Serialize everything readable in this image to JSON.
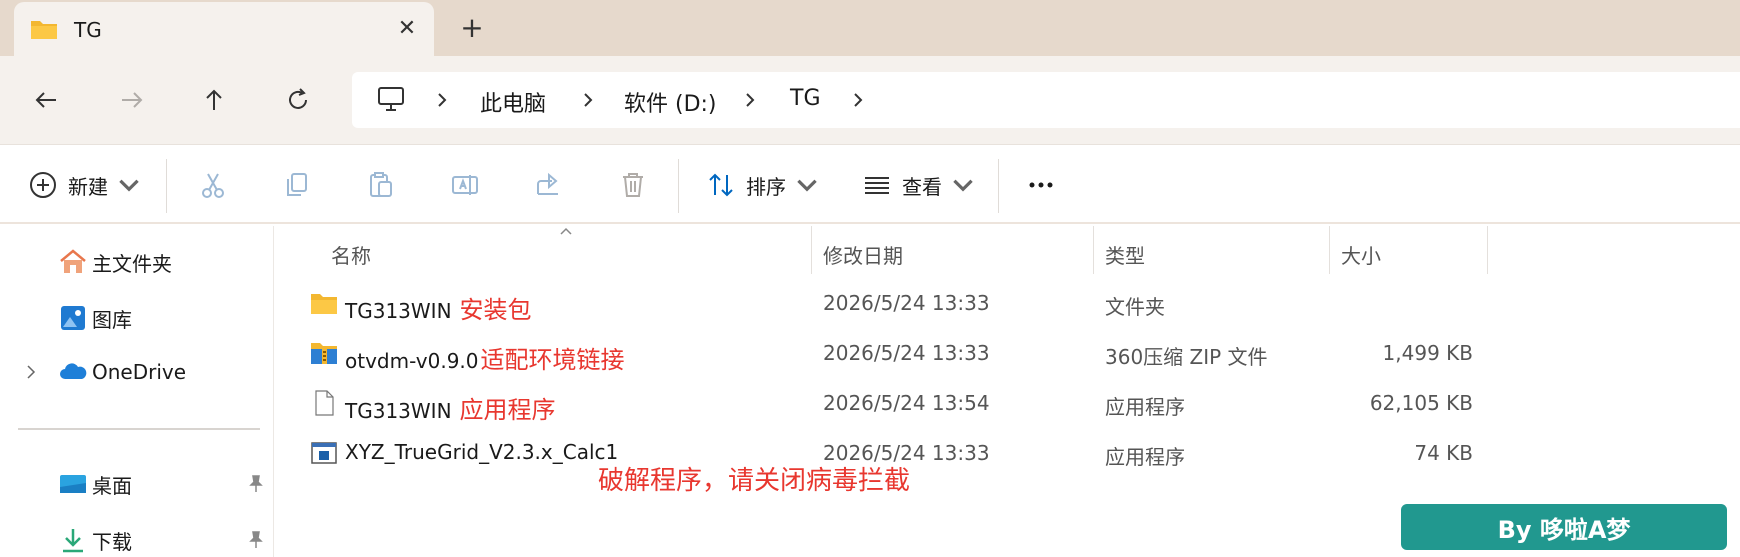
{
  "tab": {
    "title": "TG",
    "close_icon": "close-icon",
    "new_tab_icon": "plus-icon"
  },
  "nav": {
    "back": "back-arrow-icon",
    "forward": "forward-arrow-icon",
    "up": "up-arrow-icon",
    "refresh": "refresh-icon"
  },
  "breadcrumb": {
    "root_icon": "computer-icon",
    "items": [
      "此电脑",
      "软件 (D:)",
      "TG"
    ]
  },
  "toolbar": {
    "new_label": "新建",
    "sort_label": "排序",
    "view_label": "查看",
    "icons": [
      "cut-icon",
      "copy-icon",
      "paste-icon",
      "rename-icon",
      "share-icon",
      "delete-icon",
      "more-icon"
    ]
  },
  "sidebar": {
    "items": [
      {
        "label": "主文件夹",
        "icon": "home-icon"
      },
      {
        "label": "图库",
        "icon": "gallery-icon"
      },
      {
        "label": "OneDrive",
        "icon": "cloud-icon"
      },
      {
        "label": "桌面",
        "icon": "desktop-icon"
      },
      {
        "label": "下载",
        "icon": "download-icon"
      }
    ]
  },
  "columns": {
    "name": "名称",
    "date": "修改日期",
    "type": "类型",
    "size": "大小"
  },
  "files": [
    {
      "name": "TG313WIN",
      "note": "安装包",
      "date": "2026/5/24 13:33",
      "type": "文件夹",
      "size": "",
      "icon": "folder-icon"
    },
    {
      "name": "otvdm-v0.9.0",
      "note": "适配环境链接",
      "date": "2026/5/24 13:33",
      "type": "360压缩 ZIP 文件",
      "size": "1,499 KB",
      "icon": "zip-icon"
    },
    {
      "name": "TG313WIN",
      "note": "应用程序",
      "date": "2026/5/24 13:54",
      "type": "应用程序",
      "size": "62,105 KB",
      "icon": "file-icon"
    },
    {
      "name": "XYZ_TrueGrid_V2.3.x_Calc1",
      "note": "",
      "date": "2026/5/24 13:33",
      "type": "应用程序",
      "size": "74 KB",
      "icon": "app-icon"
    }
  ],
  "annotation": "破解程序，请关闭病毒拦截",
  "watermark": "By 哆啦A梦",
  "colors": {
    "accent": "#0067c0",
    "annotation": "#e8372f",
    "watermark_bg": "#21988f",
    "tabstrip": "#e6d9cc"
  }
}
